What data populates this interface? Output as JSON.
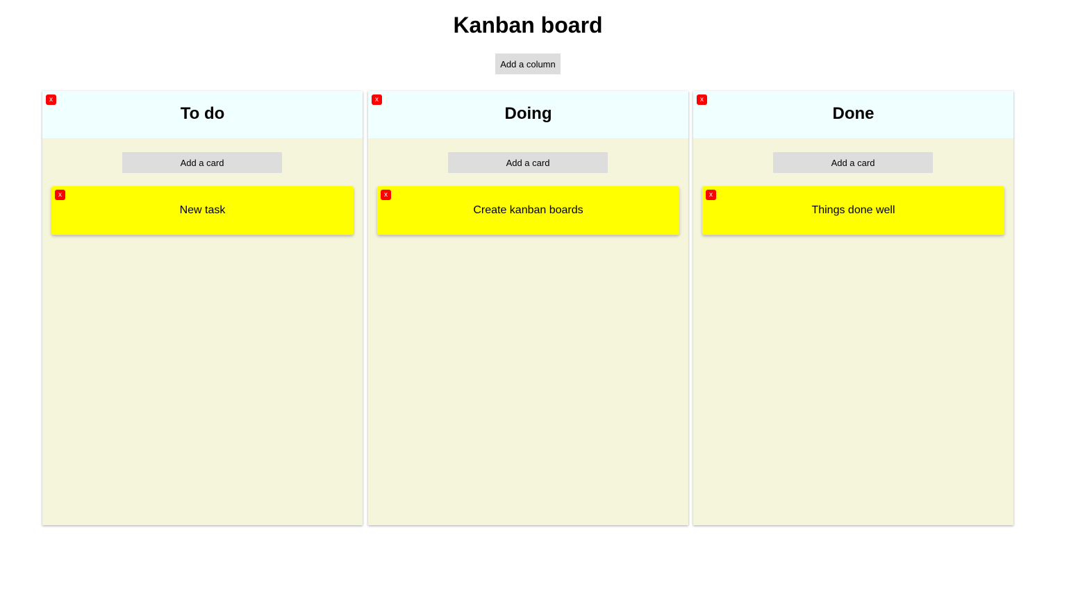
{
  "board": {
    "title": "Kanban board",
    "add_column_label": "Add a column"
  },
  "columns": [
    {
      "title": "To do",
      "delete_label": "x",
      "add_card_label": "Add a card",
      "cards": [
        {
          "text": "New task",
          "delete_label": "x"
        }
      ]
    },
    {
      "title": "Doing",
      "delete_label": "x",
      "add_card_label": "Add a card",
      "cards": [
        {
          "text": "Create kanban boards",
          "delete_label": "x"
        }
      ]
    },
    {
      "title": "Done",
      "delete_label": "x",
      "add_card_label": "Add a card",
      "cards": [
        {
          "text": "Things done well",
          "delete_label": "x"
        }
      ]
    }
  ],
  "colors": {
    "column_header_bg": "#f0ffff",
    "column_body_bg": "#f5f5dc",
    "card_bg": "#ffff00",
    "delete_bg": "#ff0000",
    "button_bg": "#dddddd"
  },
  "icons": {
    "delete": "close-icon"
  }
}
